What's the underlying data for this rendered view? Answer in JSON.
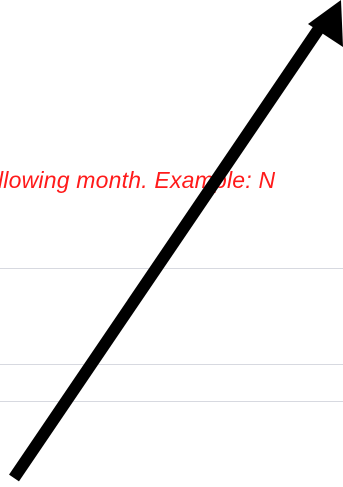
{
  "instruction": {
    "text": "llowing month. Example: N",
    "color": "#ff1a1a"
  },
  "annotation": {
    "icon": "arrow-icon",
    "color": "#000000"
  },
  "divider_color": "#d7d9e0"
}
